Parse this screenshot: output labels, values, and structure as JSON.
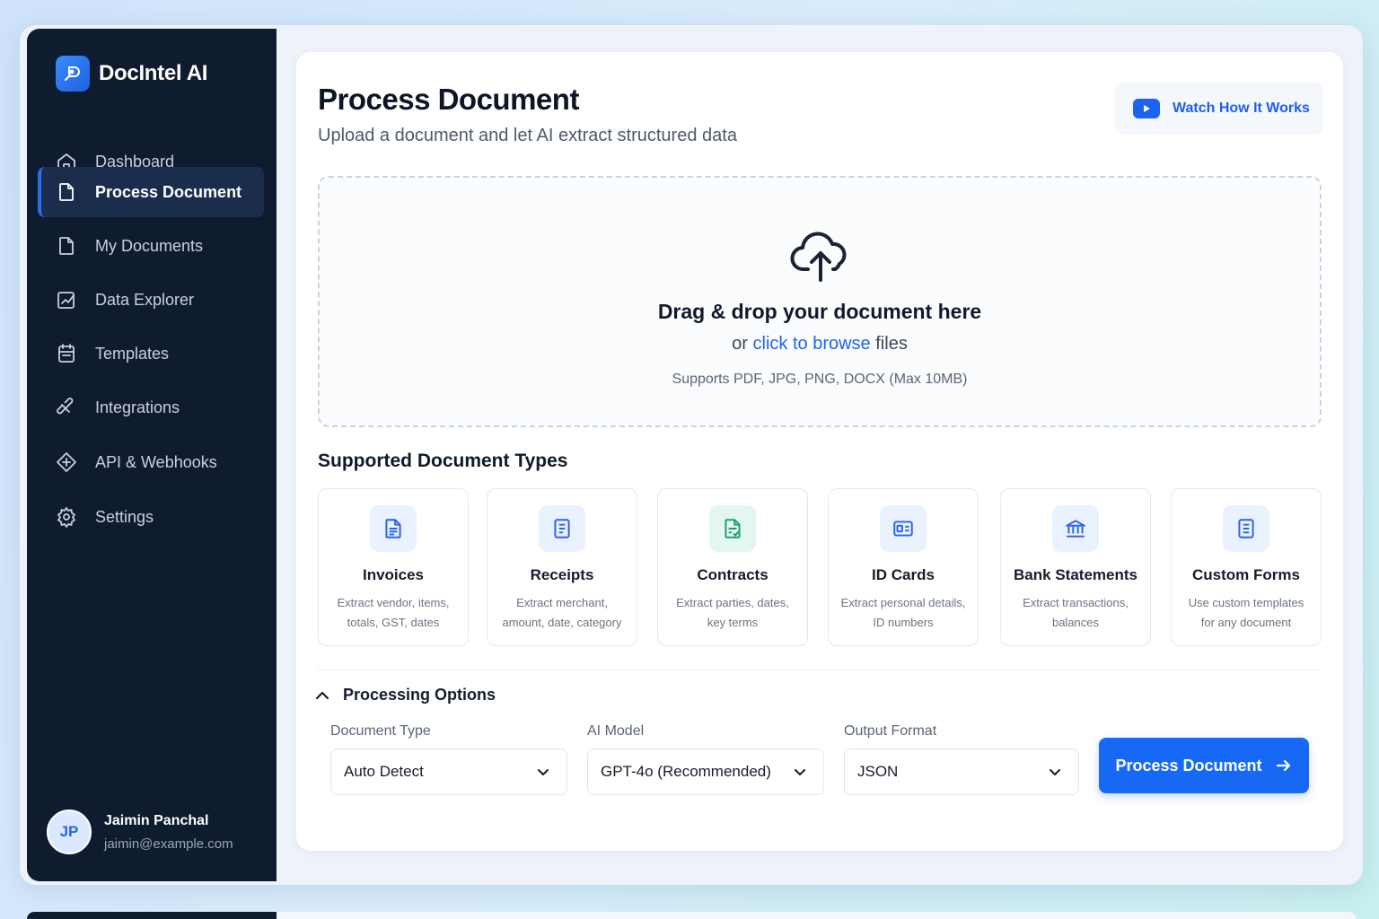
{
  "app": {
    "name": "DocIntel AI"
  },
  "sidebar": {
    "items": [
      {
        "label": "Dashboard",
        "icon": "home-icon"
      },
      {
        "label": "Process Document",
        "icon": "document-icon",
        "active": true
      },
      {
        "label": "My Documents",
        "icon": "file-icon"
      },
      {
        "label": "Data Explorer",
        "icon": "chart-edit-icon"
      },
      {
        "label": "Templates",
        "icon": "template-icon"
      },
      {
        "label": "Integrations",
        "icon": "plug-icon"
      },
      {
        "label": "API & Webhooks",
        "icon": "webhook-icon"
      },
      {
        "label": "Settings",
        "icon": "gear-icon"
      }
    ]
  },
  "user": {
    "initials": "JP",
    "name": "Jaimin Panchal",
    "email": "jaimin@example.com"
  },
  "header": {
    "title": "Process Document",
    "subtitle": "Upload a document and let AI extract structured data",
    "watch_label": "Watch How It Works"
  },
  "dropzone": {
    "title": "Drag & drop your document here",
    "prefix": "or",
    "link": "click to browse",
    "suffix": "files",
    "support": "Supports PDF, JPG, PNG, DOCX (Max 10MB)"
  },
  "types": {
    "title": "Supported Document Types",
    "items": [
      {
        "name": "Invoices",
        "line1": "Extract vendor, items,",
        "line2": "totals, GST, dates",
        "icon": "invoice-icon"
      },
      {
        "name": "Receipts",
        "line1": "Extract merchant,",
        "line2": "amount, date, category",
        "icon": "receipt-icon"
      },
      {
        "name": "Contracts",
        "line1": "Extract parties, dates,",
        "line2": "key terms",
        "icon": "contract-icon"
      },
      {
        "name": "ID Cards",
        "line1": "Extract personal details,",
        "line2": "ID numbers",
        "icon": "id-card-icon"
      },
      {
        "name": "Bank Statements",
        "line1": "Extract transactions,",
        "line2": "balances",
        "icon": "bank-icon"
      },
      {
        "name": "Custom Forms",
        "line1": "Use custom templates",
        "line2": "for any document",
        "icon": "form-icon"
      }
    ]
  },
  "options": {
    "title": "Processing Options",
    "document_type": {
      "label": "Document Type",
      "value": "Auto Detect"
    },
    "ai_model": {
      "label": "AI Model",
      "value": "GPT-4o (Recommended)"
    },
    "output_format": {
      "label": "Output Format",
      "value": "JSON"
    },
    "submit_label": "Process Document"
  },
  "colors": {
    "accent": "#1769f5",
    "sidebar": "#0f1b2e",
    "contracts_green": "#1aa06d"
  }
}
